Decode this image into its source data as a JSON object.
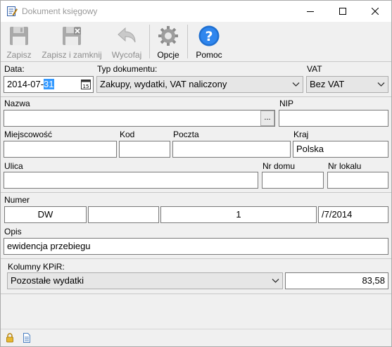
{
  "window": {
    "title": "Dokument księgowy",
    "icon": "document-edit-icon"
  },
  "toolbar": {
    "save_label": "Zapisz",
    "save_close_label": "Zapisz i zamknij",
    "undo_label": "Wycofaj",
    "options_label": "Opcje",
    "help_label": "Pomoc"
  },
  "form": {
    "date_label": "Data:",
    "date_value_prefix": "2014-07-",
    "date_value_selected": "31",
    "doc_type_label": "Typ dokumentu:",
    "doc_type_value": "Zakupy, wydatki, VAT naliczony",
    "vat_label": "VAT",
    "vat_value": "Bez VAT",
    "name_label": "Nazwa",
    "name_value": "",
    "name_lookup_label": "...",
    "nip_label": "NIP",
    "nip_value": "",
    "city_label": "Miejscowość",
    "city_value": "",
    "code_label": "Kod",
    "code_value": "",
    "post_label": "Poczta",
    "post_value": "",
    "country_label": "Kraj",
    "country_value": "Polska",
    "street_label": "Ulica",
    "street_value": "",
    "house_label": "Nr domu",
    "house_value": "",
    "flat_label": "Nr lokalu",
    "flat_value": "",
    "number_label": "Numer",
    "number_prefix": "DW",
    "number_part2": "",
    "number_value": "1",
    "number_suffix": "/7/2014",
    "desc_label": "Opis",
    "desc_value": "ewidencja przebiegu",
    "kpir_label": "Kolumny KPiR:",
    "kpir_value": "Pozostałe wydatki",
    "amount_value": "83,58"
  },
  "colors": {
    "selection": "#3399ff",
    "help_icon": "#1f6fd0"
  }
}
